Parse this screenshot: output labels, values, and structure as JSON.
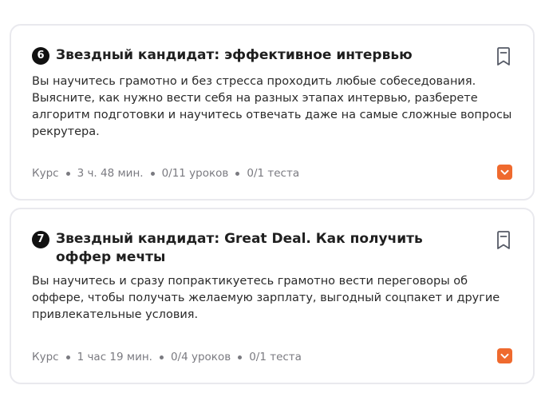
{
  "colors": {
    "accent": "#ef6a2e",
    "card_border": "#e9e9ee",
    "meta_text": "#7a7a80",
    "badge_bg": "#111111"
  },
  "courses": [
    {
      "number": "6",
      "title": "Звездный кандидат: эффективное интервью",
      "description": "Вы научитесь грамотно и без стресса проходить любые собеседования. Выясните, как нужно вести себя на разных этапах интервью, разберете алгоритм подготовки и научитесь отвечать даже на самые сложные вопросы рекрутера.",
      "type": "Курс",
      "duration": "3 ч. 48 мин.",
      "lessons": "0/11 уроков",
      "tests": "0/1 теста",
      "bookmark_icon": "bookmark-icon",
      "expand_icon": "chevron-down-icon"
    },
    {
      "number": "7",
      "title": "Звездный кандидат: Great Deal. Как получить оффер мечты",
      "description": "Вы научитесь и сразу попрактикуетесь грамотно вести переговоры об оффере, чтобы получать желаемую зарплату, выгодный соцпакет и другие привлекательные условия.",
      "type": "Курс",
      "duration": "1 час 19 мин.",
      "lessons": "0/4 уроков",
      "tests": "0/1 теста",
      "bookmark_icon": "bookmark-icon",
      "expand_icon": "chevron-down-icon"
    }
  ]
}
